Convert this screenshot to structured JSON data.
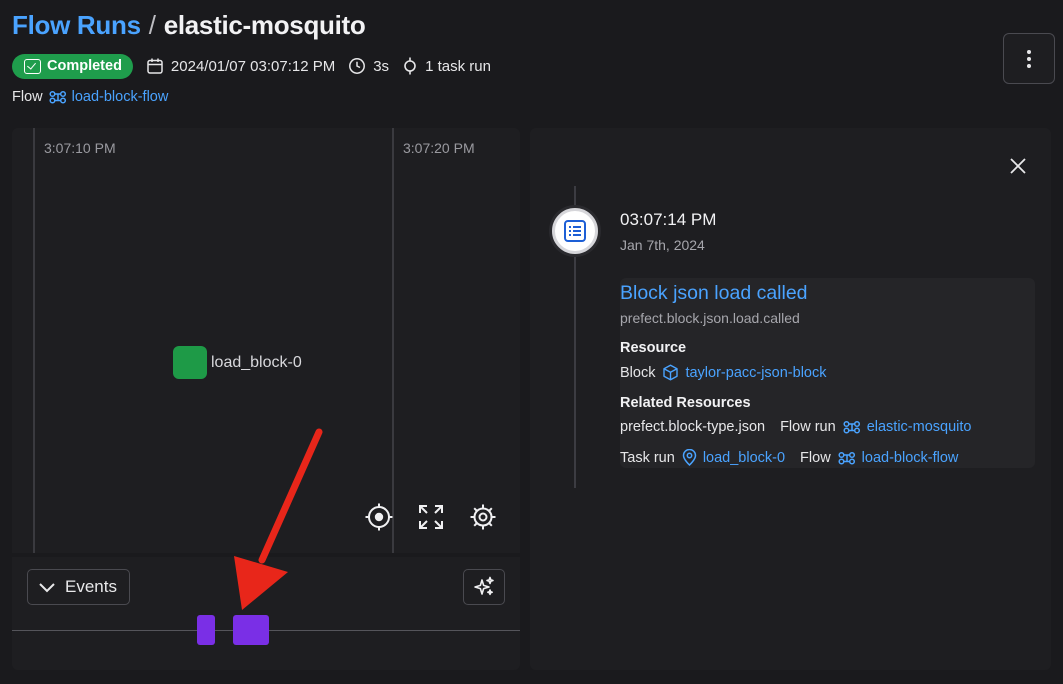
{
  "breadcrumb": {
    "parent": "Flow Runs",
    "separator": "/",
    "current": "elastic-mosquito"
  },
  "status": {
    "label": "Completed",
    "color": "#1f9d4c"
  },
  "meta": {
    "start_time": "2024/01/07 03:07:12 PM",
    "duration": "3s",
    "task_runs": "1 task run"
  },
  "flow": {
    "label": "Flow",
    "name": "load-block-flow"
  },
  "graph": {
    "time_labels": [
      "3:07:10 PM",
      "3:07:20 PM"
    ],
    "node": {
      "label": "load_block-0",
      "color": "#1e9a47"
    },
    "tools": [
      "recenter-icon",
      "fullscreen-icon",
      "settings-icon"
    ]
  },
  "events_panel": {
    "toggle_label": "Events",
    "mark_color": "#7a2fe6"
  },
  "annotation": {
    "arrow_color": "#e8261a"
  },
  "event_detail": {
    "time": "03:07:14 PM",
    "date": "Jan 7th, 2024",
    "title": "Block json load called",
    "event_name": "prefect.block.json.load.called",
    "resource_heading": "Resource",
    "resource": {
      "kind": "Block",
      "name": "taylor-pacc-json-block"
    },
    "related_heading": "Related Resources",
    "related": {
      "block_type": "prefect.block-type.json",
      "flow_run_label": "Flow run",
      "flow_run": "elastic-mosquito",
      "task_run_label": "Task run",
      "task_run": "load_block-0",
      "flow_label": "Flow",
      "flow": "load-block-flow"
    }
  },
  "accent_color": "#4aa3ff"
}
